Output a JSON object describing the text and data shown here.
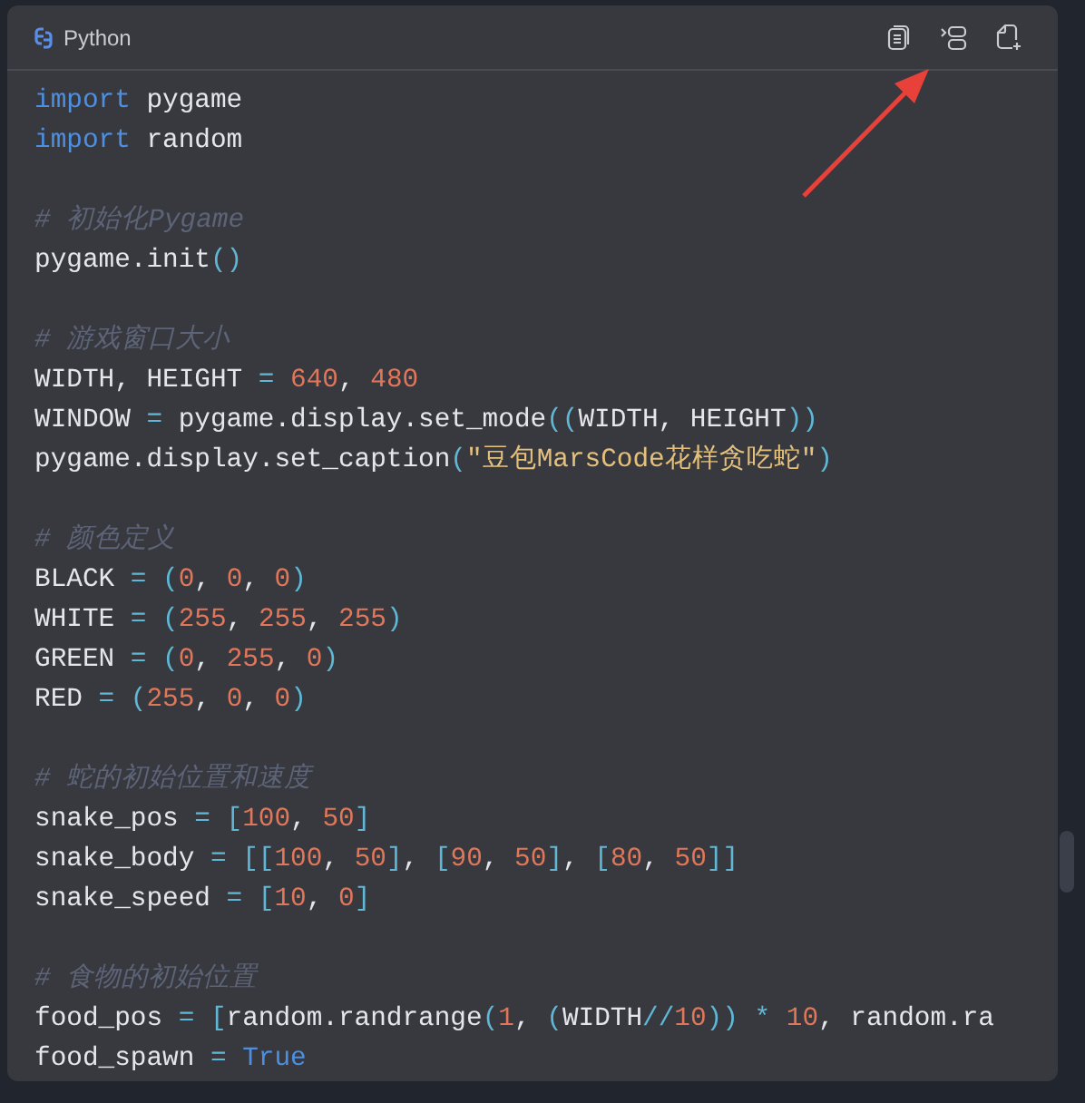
{
  "code_block": {
    "language": "Python",
    "lines": [
      {
        "kind": "code",
        "tokens": [
          {
            "kind": "keyword",
            "text": "import"
          },
          {
            "kind": "plain",
            "text": " pygame"
          }
        ]
      },
      {
        "kind": "code",
        "tokens": [
          {
            "kind": "keyword",
            "text": "import"
          },
          {
            "kind": "plain",
            "text": " random"
          }
        ]
      },
      {
        "kind": "blank"
      },
      {
        "kind": "code",
        "tokens": [
          {
            "kind": "comment",
            "text": "# 初始化Pygame"
          }
        ]
      },
      {
        "kind": "code",
        "tokens": [
          {
            "kind": "plain",
            "text": "pygame.init"
          },
          {
            "kind": "op",
            "text": "()"
          }
        ]
      },
      {
        "kind": "blank"
      },
      {
        "kind": "code",
        "tokens": [
          {
            "kind": "comment",
            "text": "# 游戏窗口大小"
          }
        ]
      },
      {
        "kind": "code",
        "tokens": [
          {
            "kind": "plain",
            "text": "WIDTH, HEIGHT "
          },
          {
            "kind": "op",
            "text": "= "
          },
          {
            "kind": "number",
            "text": "640"
          },
          {
            "kind": "plain",
            "text": ", "
          },
          {
            "kind": "number",
            "text": "480"
          }
        ]
      },
      {
        "kind": "code",
        "tokens": [
          {
            "kind": "plain",
            "text": "WINDOW "
          },
          {
            "kind": "op",
            "text": "="
          },
          {
            "kind": "plain",
            "text": " pygame.display.set_mode"
          },
          {
            "kind": "op",
            "text": "(("
          },
          {
            "kind": "plain",
            "text": "WIDTH, HEIGHT"
          },
          {
            "kind": "op",
            "text": "))"
          }
        ]
      },
      {
        "kind": "code",
        "tokens": [
          {
            "kind": "plain",
            "text": "pygame.display.set_caption"
          },
          {
            "kind": "op",
            "text": "("
          },
          {
            "kind": "string",
            "text": "\"豆包MarsCode花样贪吃蛇\""
          },
          {
            "kind": "op",
            "text": ")"
          }
        ]
      },
      {
        "kind": "blank"
      },
      {
        "kind": "code",
        "tokens": [
          {
            "kind": "comment",
            "text": "# 颜色定义"
          }
        ]
      },
      {
        "kind": "code",
        "tokens": [
          {
            "kind": "plain",
            "text": "BLACK "
          },
          {
            "kind": "op",
            "text": "= ("
          },
          {
            "kind": "number",
            "text": "0"
          },
          {
            "kind": "plain",
            "text": ", "
          },
          {
            "kind": "number",
            "text": "0"
          },
          {
            "kind": "plain",
            "text": ", "
          },
          {
            "kind": "number",
            "text": "0"
          },
          {
            "kind": "op",
            "text": ")"
          }
        ]
      },
      {
        "kind": "code",
        "tokens": [
          {
            "kind": "plain",
            "text": "WHITE "
          },
          {
            "kind": "op",
            "text": "= ("
          },
          {
            "kind": "number",
            "text": "255"
          },
          {
            "kind": "plain",
            "text": ", "
          },
          {
            "kind": "number",
            "text": "255"
          },
          {
            "kind": "plain",
            "text": ", "
          },
          {
            "kind": "number",
            "text": "255"
          },
          {
            "kind": "op",
            "text": ")"
          }
        ]
      },
      {
        "kind": "code",
        "tokens": [
          {
            "kind": "plain",
            "text": "GREEN "
          },
          {
            "kind": "op",
            "text": "= ("
          },
          {
            "kind": "number",
            "text": "0"
          },
          {
            "kind": "plain",
            "text": ", "
          },
          {
            "kind": "number",
            "text": "255"
          },
          {
            "kind": "plain",
            "text": ", "
          },
          {
            "kind": "number",
            "text": "0"
          },
          {
            "kind": "op",
            "text": ")"
          }
        ]
      },
      {
        "kind": "code",
        "tokens": [
          {
            "kind": "plain",
            "text": "RED "
          },
          {
            "kind": "op",
            "text": "= ("
          },
          {
            "kind": "number",
            "text": "255"
          },
          {
            "kind": "plain",
            "text": ", "
          },
          {
            "kind": "number",
            "text": "0"
          },
          {
            "kind": "plain",
            "text": ", "
          },
          {
            "kind": "number",
            "text": "0"
          },
          {
            "kind": "op",
            "text": ")"
          }
        ]
      },
      {
        "kind": "blank"
      },
      {
        "kind": "code",
        "tokens": [
          {
            "kind": "comment",
            "text": "# 蛇的初始位置和速度"
          }
        ]
      },
      {
        "kind": "code",
        "tokens": [
          {
            "kind": "plain",
            "text": "snake_pos "
          },
          {
            "kind": "op",
            "text": "= ["
          },
          {
            "kind": "number",
            "text": "100"
          },
          {
            "kind": "plain",
            "text": ", "
          },
          {
            "kind": "number",
            "text": "50"
          },
          {
            "kind": "op",
            "text": "]"
          }
        ]
      },
      {
        "kind": "code",
        "tokens": [
          {
            "kind": "plain",
            "text": "snake_body "
          },
          {
            "kind": "op",
            "text": "= [["
          },
          {
            "kind": "number",
            "text": "100"
          },
          {
            "kind": "plain",
            "text": ", "
          },
          {
            "kind": "number",
            "text": "50"
          },
          {
            "kind": "op",
            "text": "]"
          },
          {
            "kind": "plain",
            "text": ", "
          },
          {
            "kind": "op",
            "text": "["
          },
          {
            "kind": "number",
            "text": "90"
          },
          {
            "kind": "plain",
            "text": ", "
          },
          {
            "kind": "number",
            "text": "50"
          },
          {
            "kind": "op",
            "text": "]"
          },
          {
            "kind": "plain",
            "text": ", "
          },
          {
            "kind": "op",
            "text": "["
          },
          {
            "kind": "number",
            "text": "80"
          },
          {
            "kind": "plain",
            "text": ", "
          },
          {
            "kind": "number",
            "text": "50"
          },
          {
            "kind": "op",
            "text": "]]"
          }
        ]
      },
      {
        "kind": "code",
        "tokens": [
          {
            "kind": "plain",
            "text": "snake_speed "
          },
          {
            "kind": "op",
            "text": "= ["
          },
          {
            "kind": "number",
            "text": "10"
          },
          {
            "kind": "plain",
            "text": ", "
          },
          {
            "kind": "number",
            "text": "0"
          },
          {
            "kind": "op",
            "text": "]"
          }
        ]
      },
      {
        "kind": "blank"
      },
      {
        "kind": "code",
        "tokens": [
          {
            "kind": "comment",
            "text": "# 食物的初始位置"
          }
        ]
      },
      {
        "kind": "code",
        "tokens": [
          {
            "kind": "plain",
            "text": "food_pos "
          },
          {
            "kind": "op",
            "text": "= ["
          },
          {
            "kind": "plain",
            "text": "random.randrange"
          },
          {
            "kind": "op",
            "text": "("
          },
          {
            "kind": "number",
            "text": "1"
          },
          {
            "kind": "plain",
            "text": ", "
          },
          {
            "kind": "op",
            "text": "("
          },
          {
            "kind": "plain",
            "text": "WIDTH"
          },
          {
            "kind": "op",
            "text": "//"
          },
          {
            "kind": "number",
            "text": "10"
          },
          {
            "kind": "op",
            "text": ")) * "
          },
          {
            "kind": "number",
            "text": "10"
          },
          {
            "kind": "plain",
            "text": ", random.ra"
          }
        ]
      },
      {
        "kind": "code",
        "tokens": [
          {
            "kind": "plain",
            "text": "food_spawn "
          },
          {
            "kind": "op",
            "text": "= "
          },
          {
            "kind": "keyword",
            "text": "True"
          }
        ]
      }
    ]
  }
}
